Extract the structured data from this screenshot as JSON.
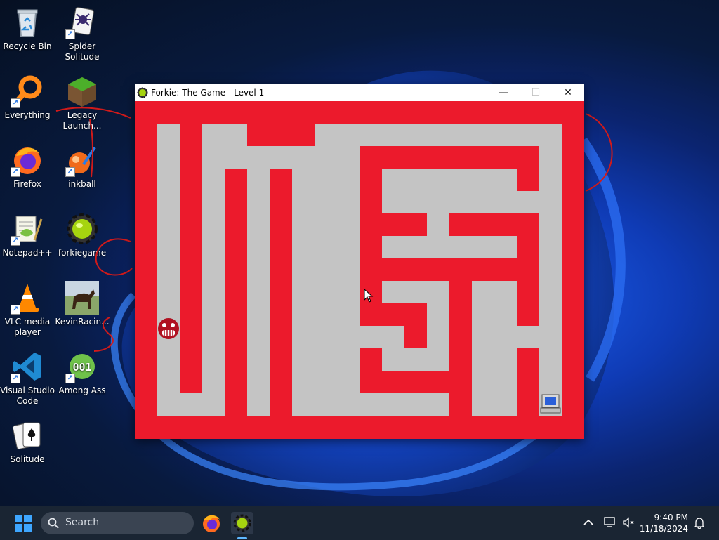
{
  "desktop": {
    "icons": [
      {
        "label": "Recycle Bin",
        "icon": "recycle-bin-icon",
        "shortcut": false
      },
      {
        "label": "Spider Solitude",
        "icon": "spider-solitaire-icon",
        "shortcut": true
      },
      {
        "label": "Everything",
        "icon": "everything-search-icon",
        "shortcut": true
      },
      {
        "label": "Legacy Launch...",
        "icon": "minecraft-legacy-launcher-icon",
        "shortcut": true
      },
      {
        "label": "Firefox",
        "icon": "firefox-icon",
        "shortcut": true
      },
      {
        "label": "inkball",
        "icon": "inkball-icon",
        "shortcut": true
      },
      {
        "label": "Notepad++",
        "icon": "notepad-plus-plus-icon",
        "shortcut": true
      },
      {
        "label": "forkiegame",
        "icon": "forkie-gear-icon",
        "shortcut": true
      },
      {
        "label": "VLC media player",
        "icon": "vlc-cone-icon",
        "shortcut": true
      },
      {
        "label": "KevinRacin...",
        "icon": "horse-photo-icon",
        "shortcut": false
      },
      {
        "label": "Visual Studio Code",
        "icon": "vscode-icon",
        "shortcut": true
      },
      {
        "label": "Among Ass",
        "icon": "among-ass-001-icon",
        "shortcut": true
      },
      {
        "label": "Solitude",
        "icon": "solitaire-cards-icon",
        "shortcut": false
      }
    ]
  },
  "window": {
    "title": "Forkie: The Game - Level 1",
    "minimize": "—",
    "maximize": "☐",
    "close": "✕"
  },
  "game": {
    "colors": {
      "wall": "#ec1a2c",
      "path": "#c4c4c4"
    },
    "player": "red-creature-sprite",
    "goal": "computer-sprite"
  },
  "taskbar": {
    "search_label": "Search",
    "time": "9:40 PM",
    "date": "11/18/2024"
  }
}
